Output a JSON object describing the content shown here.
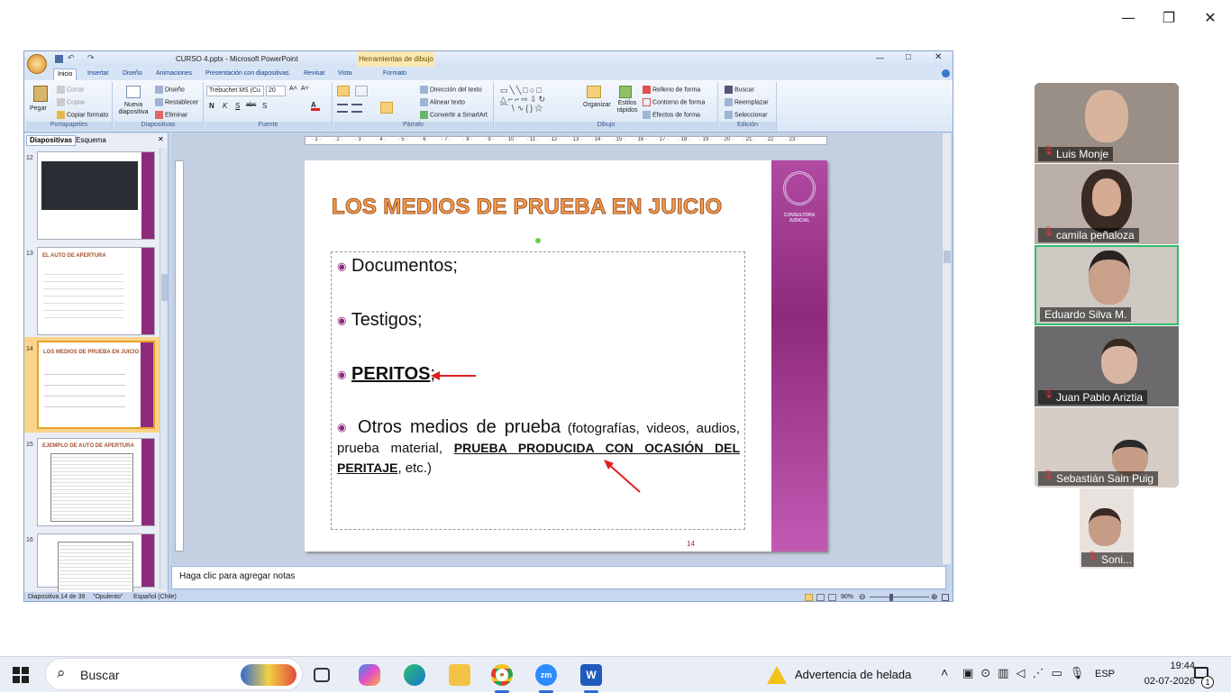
{
  "zoom_controls": {
    "minimize": "—",
    "restore": "❐",
    "close": "✕"
  },
  "ppt": {
    "window_title": "CURSO 4.pptx - Microsoft PowerPoint",
    "context_tab": "Herramientas de dibujo",
    "win_btns": {
      "min": "—",
      "max": "□",
      "close": "✕"
    },
    "tabs": [
      "Inicio",
      "Insertar",
      "Diseño",
      "Animaciones",
      "Presentación con diapositivas",
      "Revisar",
      "Vista",
      "Formato"
    ],
    "ribbon": {
      "portapapeles": {
        "paste": "Pegar",
        "cut": "Cortar",
        "copy": "Copiar",
        "format_painter": "Copiar formato",
        "label": "Portapapeles"
      },
      "diapositivas": {
        "new": "Nueva diapositiva",
        "layout": "Diseño",
        "reset": "Restablecer",
        "delete": "Eliminar",
        "label": "Diapositivas"
      },
      "fuente": {
        "font_name": "Trebuchet MS (Cu",
        "font_size": "20",
        "bold": "N",
        "italic": "K",
        "underline": "S",
        "strike": "abc",
        "shadow": "S",
        "label": "Fuente"
      },
      "parrafo": {
        "text_dir": "Dirección del texto",
        "align_text": "Alinear texto",
        "smartart": "Convertir a SmartArt",
        "label": "Párrafo"
      },
      "dibujo": {
        "arrange": "Organizar",
        "quick_styles": "Estilos rápidos",
        "fill": "Relleno de forma",
        "outline": "Contorno de forma",
        "effects": "Efectos de forma",
        "label": "Dibujo"
      },
      "edicion": {
        "find": "Buscar",
        "replace": "Reemplazar",
        "select": "Seleccionar",
        "label": "Edición"
      }
    },
    "pane_tabs": {
      "slides": "Diapositivas",
      "outline": "Esquema",
      "close": "✕"
    },
    "thumbnails": [
      {
        "num": "12",
        "title": ""
      },
      {
        "num": "13",
        "title": "EL AUTO DE APERTURA"
      },
      {
        "num": "14",
        "title": "LOS MEDIOS DE PRUEBA EN JUICIO"
      },
      {
        "num": "15",
        "title": "EJEMPLO DE AUTO DE APERTURA"
      },
      {
        "num": "16",
        "title": ""
      }
    ],
    "ruler_marks": [
      "1",
      "2",
      "3",
      "4",
      "5",
      "6",
      "7",
      "8",
      "9",
      "10",
      "11",
      "12",
      "13",
      "14",
      "15",
      "16",
      "17",
      "18",
      "19",
      "20",
      "21",
      "22",
      "23"
    ],
    "slide": {
      "title": "LOS MEDIOS DE PRUEBA EN JUICIO",
      "logo_text": "CONSULTORA JUDICIAL",
      "bullet1": "Documentos;",
      "bullet2": "Testigos;",
      "bullet3_main": "PERITOS",
      "bullet3_tail": ";",
      "bullet4_a": "Otros medios de prueba",
      "bullet4_b": " (fotografías, videos, audios, prueba material, ",
      "bullet4_c": "PRUEBA PRODUCIDA CON OCASIÓN DEL PERITAJE",
      "bullet4_d": ", etc.)",
      "page_number": "14"
    },
    "notes_placeholder": "Haga clic para agregar notas",
    "status": {
      "slide_info": "Diapositiva 14 de 39",
      "theme": "\"Opulento\"",
      "language": "Español (Chile)",
      "zoom": "90%"
    }
  },
  "participants": [
    {
      "name": "Luis Monje",
      "bg": "#9a8f86"
    },
    {
      "name": "camila peñaloza",
      "bg": "#b9aea8"
    },
    {
      "name": "Eduardo Silva M.",
      "bg": "#cfc9c4"
    },
    {
      "name": "Juan Pablo Ariztia",
      "bg": "#6c6a6c"
    },
    {
      "name": "Sebastián Sain Puig",
      "bg": "#d6cdc6"
    },
    {
      "name": "Soni...",
      "bg": "#e8e2de"
    }
  ],
  "taskbar": {
    "search": "Buscar",
    "weather": "Advertencia de helada",
    "lang": "ESP",
    "time": "19:44",
    "date": "02-07-2026",
    "notif_count": "1"
  },
  "colors": {
    "slide_accent": "#8e2a7c",
    "title_orange": "#f3a04a",
    "zoom_active_border": "#2ebd6f",
    "arrow_red": "#e02020"
  }
}
